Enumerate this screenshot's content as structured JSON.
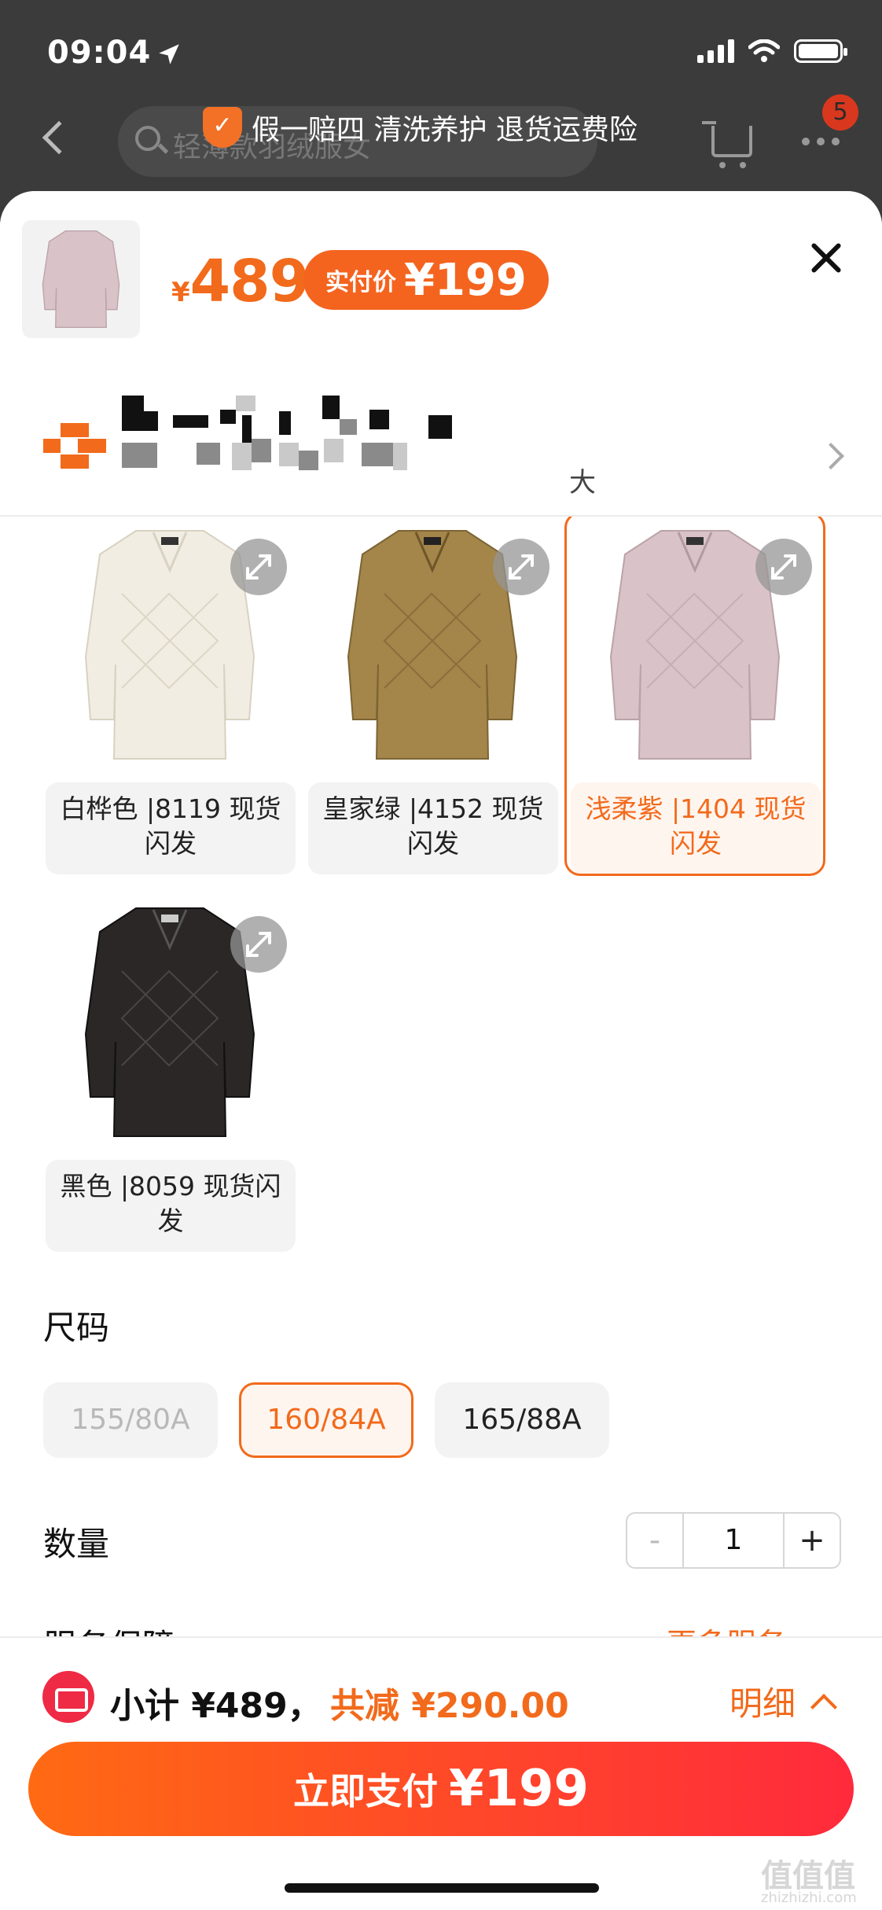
{
  "status_bar": {
    "time": "09:04"
  },
  "top_bar": {
    "search_placeholder": "轻薄款羽绒服女",
    "guarantee_text": "假一赔四 清洗养护 退货运费险",
    "badge_count": "5"
  },
  "sheet": {
    "price": {
      "currency": "¥",
      "amount": "489"
    },
    "real_price": {
      "label": "实付价",
      "currency": "¥",
      "amount": "199"
    },
    "shop": {
      "trailing_char": "大"
    },
    "variants": [
      {
        "label": "白桦色 |8119 现货闪发",
        "color": "#f1ede2",
        "selected": false
      },
      {
        "label": "皇家绿 |4152 现货闪发",
        "color": "#a4854a",
        "selected": false
      },
      {
        "label": "浅柔紫 |1404 现货闪发",
        "color": "#d9c3c8",
        "selected": true
      },
      {
        "label": "黑色 |8059 现货闪发",
        "color": "#2a2726",
        "selected": false
      }
    ],
    "size": {
      "title": "尺码",
      "options": [
        {
          "label": "155/80A",
          "state": "disabled"
        },
        {
          "label": "160/84A",
          "state": "selected"
        },
        {
          "label": "165/88A",
          "state": "normal"
        }
      ]
    },
    "quantity": {
      "title": "数量",
      "minus": "-",
      "value": "1",
      "plus": "+"
    },
    "service": {
      "title": "服务保障",
      "more": "更多服务"
    }
  },
  "bottom_bar": {
    "subtotal": "小计 ¥489，",
    "discount": "共减 ¥290.00",
    "detail": "明细",
    "pay_label": "立即支付",
    "pay_currency": "¥",
    "pay_amount": "199"
  },
  "watermark": {
    "text": "值值值",
    "sub": "zhizhizhi.com"
  },
  "colors": {
    "accent": "#f26a1b",
    "pay_gradient_start": "#ff6a13",
    "pay_gradient_end": "#ff2a3c"
  }
}
